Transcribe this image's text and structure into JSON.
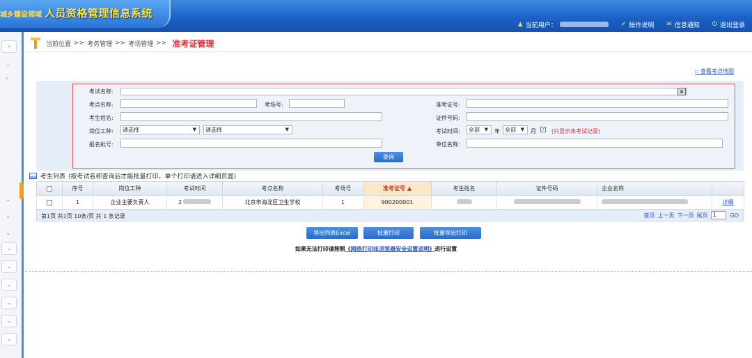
{
  "header": {
    "logo_small": "城乡建设领域",
    "logo_big": "人员资格管理信息系统",
    "current_user_label": "当前用户：",
    "nav": [
      "操作说明",
      "信息通知",
      "退出登录"
    ]
  },
  "breadcrumb": {
    "label": "当前位置",
    "sep": ">>",
    "items": [
      "考务管理",
      "考场管理"
    ],
    "current": "准考证管理"
  },
  "map_link": "查看考点地图",
  "search": {
    "exam_name_label": "考试名称:",
    "exam_site_label": "考点名称:",
    "room_no_label": "考场号:",
    "ticket_no_label": "准考证号:",
    "name_label": "考生姓名:",
    "id_no_label": "证件号码:",
    "job_label": "岗位工种:",
    "job_select1": "请选择",
    "job_select2": "请选择",
    "exam_time_label": "考试时间:",
    "year_value": "全部",
    "year_unit": "年",
    "month_value": "全部",
    "month_unit": "月",
    "only_unexamined": "(只显示未考试记录)",
    "batch_label": "报名批号:",
    "company_label": "单位名称:",
    "query_button": "查询"
  },
  "list": {
    "title": "考生列表",
    "note": "(按考试名称查询后才能批量打印，单个打印请进入详细页面)",
    "columns": [
      "序号",
      "岗位工种",
      "考试时间",
      "考点名称",
      "考场号",
      "准考证号 ▲",
      "考生姓名",
      "证件号码",
      "企业名称",
      ""
    ],
    "rows": [
      {
        "index": "1",
        "job": "企业主要负责人",
        "time": "2",
        "site": "北京市海淀区卫生学校",
        "room": "1",
        "ticket": "900200001",
        "action": "详细"
      }
    ]
  },
  "pager": {
    "summary": "第1页 共1页 10条/页 共 1 条记录",
    "first": "首页",
    "prev": "上一页",
    "next": "下一页",
    "last": "尾页",
    "page_value": "1",
    "go": "GO"
  },
  "actions": {
    "export": "导出列表Excel",
    "batch_print": "批量打印",
    "batch_export_print": "批量导出打印"
  },
  "help": {
    "before": "如果无法打印请按照",
    "link": "《网络打印IE浏览器安全设置说明》",
    "after": "进行设置"
  },
  "colors": {
    "header": "#1a5fc4",
    "logo_text": "#ffe14a",
    "current_red": "#e03030",
    "link": "#2a56c6"
  }
}
